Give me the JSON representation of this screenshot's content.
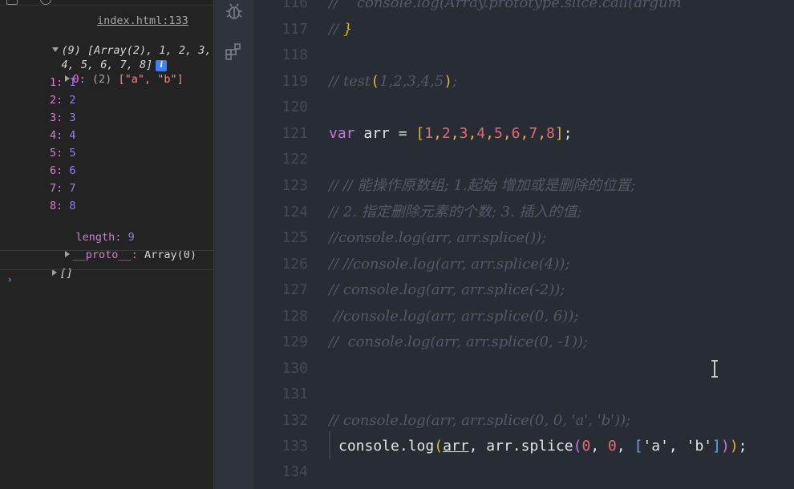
{
  "console": {
    "source_link": "index.html:133",
    "summary_line1": "(9) [Array(2), 1, 2, 3,",
    "summary_line2": "4, 5, 6, 7, 8]",
    "info_badge": "i",
    "item0_key": "0:",
    "item0_preview_prefix": "(2)",
    "item0_preview": "[\"a\", \"b\"]",
    "items": [
      {
        "key": "1:",
        "value": "1"
      },
      {
        "key": "2:",
        "value": "2"
      },
      {
        "key": "3:",
        "value": "3"
      },
      {
        "key": "4:",
        "value": "4"
      },
      {
        "key": "5:",
        "value": "5"
      },
      {
        "key": "6:",
        "value": "6"
      },
      {
        "key": "7:",
        "value": "7"
      },
      {
        "key": "8:",
        "value": "8"
      }
    ],
    "length_key": "length:",
    "length_value": "9",
    "proto_key": "__proto__:",
    "proto_value": "Array(0)",
    "second_log": "[]",
    "prompt": "›"
  },
  "editor": {
    "line_numbers": [
      "116",
      "117",
      "118",
      "119",
      "120",
      "121",
      "122",
      "123",
      "124",
      "125",
      "126",
      "127",
      "128",
      "129",
      "130",
      "131",
      "132",
      "133",
      "134"
    ],
    "lines": {
      "l116": "//    console.log(Array.prototype.slice.call(argum",
      "l117_comment": "// ",
      "l117_brace": "}",
      "l119_comment": "// test",
      "l119_args": "1,2,3,4,5",
      "l121_kw": "var",
      "l121_name": "arr",
      "l121_eq": " = ",
      "l121_values": [
        "1",
        "2",
        "3",
        "4",
        "5",
        "6",
        "7",
        "8"
      ],
      "l123": "// // 能操作原数组; 1.起始 增加或是删除的位置;",
      "l124": "// 2. 指定删除元素的个数; 3. 插入的值;",
      "l125": "//console.log(arr, arr.splice());",
      "l126": "// //console.log(arr, arr.splice(4));",
      "l127": "// console.log(arr, arr.splice(-2));",
      "l128": " //console.log(arr, arr.splice(0, 6));",
      "l129": "//  console.log(arr, arr.splice(0, -1));",
      "l132": "// console.log(arr, arr.splice(0, 0, 'a', 'b'));",
      "l133_obj": "console",
      "l133_fn": "log",
      "l133_arg1": "arr",
      "l133_obj2": "arr",
      "l133_fn2": "splice",
      "l133_n1": "0",
      "l133_n2": "0",
      "l133_s1": "'a'",
      "l133_s2": "'b'"
    }
  },
  "icons": {
    "debug": "bug-icon",
    "extensions": "extensions-icon",
    "cursor": "text-cursor-icon"
  }
}
